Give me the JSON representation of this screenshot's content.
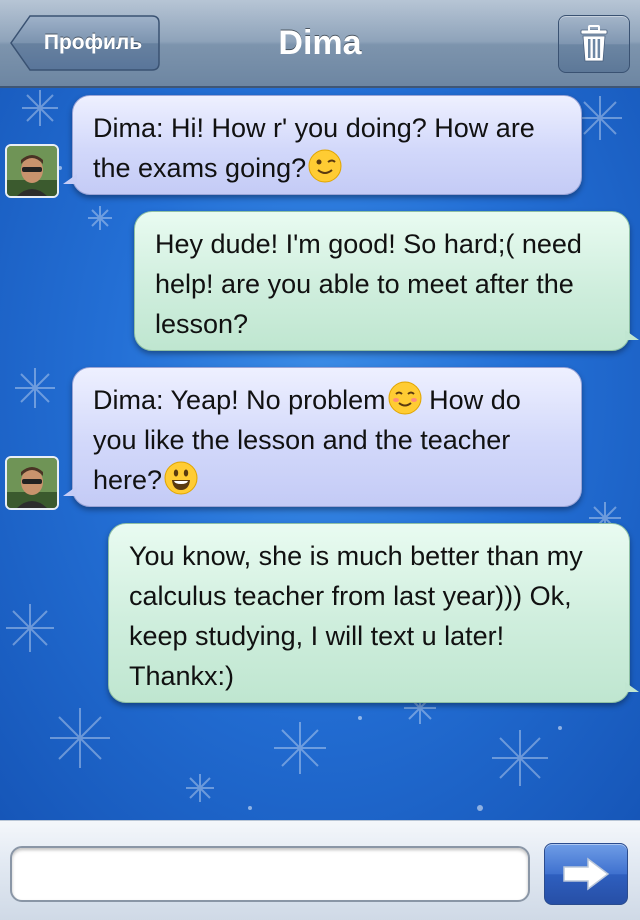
{
  "nav": {
    "back_label": "Профиль",
    "title": "Dima",
    "trash_icon": "trash-icon"
  },
  "messages": [
    {
      "direction": "incoming",
      "text": "Dima: Hi! How r' you doing? How are the exams going?",
      "emoji": "winking-face"
    },
    {
      "direction": "outgoing",
      "text": "Hey dude! I'm good! So hard;( need help! are you able to meet after the lesson?"
    },
    {
      "direction": "incoming",
      "text_before_emoji": "Dima: Yeap! No problem",
      "emoji": "smiling-face",
      "text_after_emoji": " How do you like the lesson and the teacher here?",
      "emoji_end": "grinning-face"
    },
    {
      "direction": "outgoing",
      "text": "You know, she is much better than my calculus teacher from last year))) Ok, keep studying, I will text u later! Thankx:)"
    }
  ],
  "input": {
    "value": "",
    "placeholder": ""
  },
  "send_icon": "right-arrow-icon",
  "colors": {
    "incoming_bubble": "#d2d8fa",
    "outgoing_bubble": "#cfeedd",
    "background": "#2470d6",
    "navbar": "#8ea3ba"
  }
}
